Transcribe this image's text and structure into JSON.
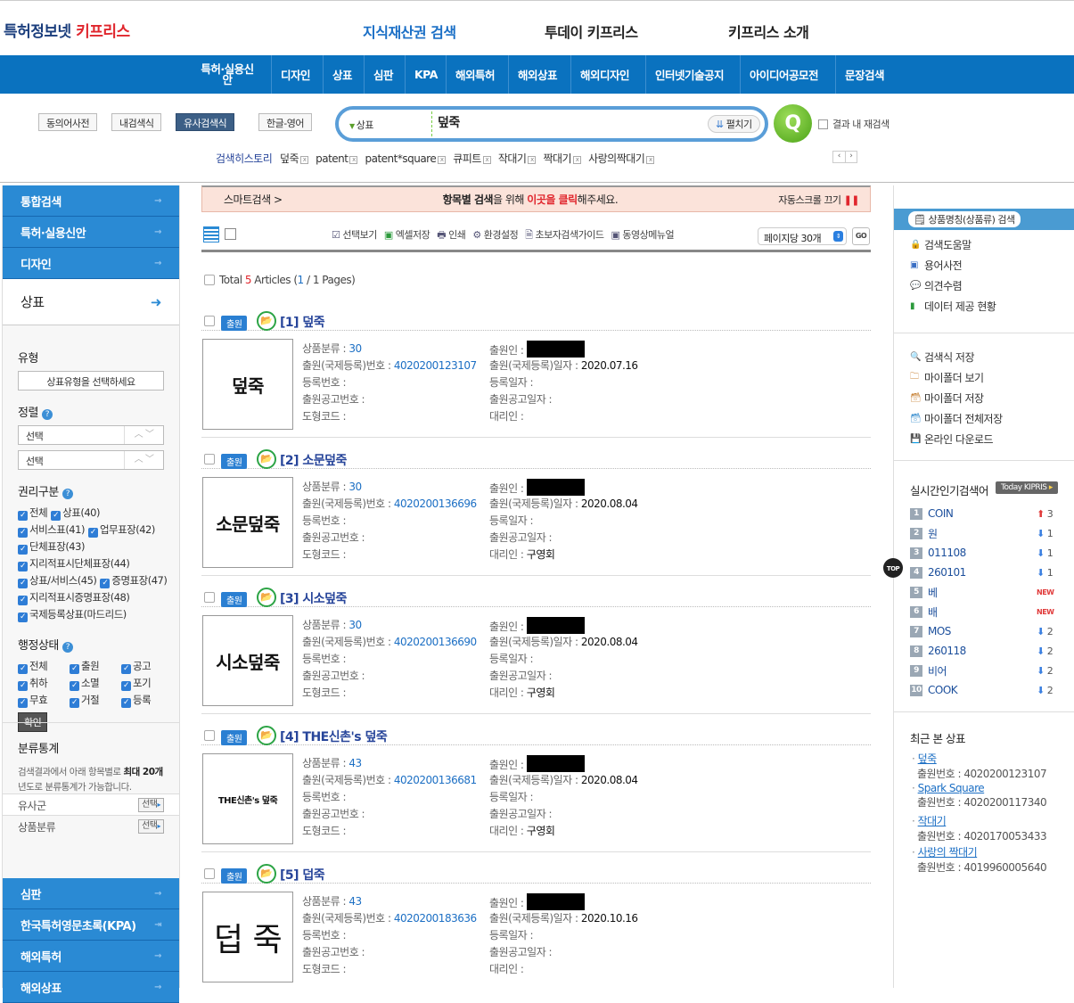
{
  "header": {
    "logo_main": "특허정보넷 ",
    "logo_accent": "키프리스",
    "tabs": [
      "지식재산권 검색",
      "투데이 키프리스",
      "키프리스 소개"
    ]
  },
  "nav": [
    "특허·실용신안",
    "디자인",
    "상표",
    "심판",
    "KPA",
    "해외특허",
    "해외상표",
    "해외디자인",
    "인터넷기술공지",
    "아이디어공모전",
    "문장검색"
  ],
  "search": {
    "tools": [
      "동의어사전",
      "내검색식",
      "유사검색식",
      "한글-영어"
    ],
    "category": "상표",
    "query": "덮죽",
    "expand": "펼치기",
    "within": "결과 내 재검색",
    "history_label": "검색히스토리",
    "history": [
      "덮죽",
      "patent",
      "patent*square",
      "큐피트",
      "작대기",
      "짝대기",
      "사랑의짝대기"
    ]
  },
  "left": {
    "top_items": [
      "통합검색",
      "특허·실용신안",
      "디자인"
    ],
    "selected": "상표",
    "type_label": "유형",
    "type_placeholder": "상표유형을 선택하세요",
    "sort_label": "정렬",
    "sort1": "선택",
    "sort2": "선택",
    "rights_label": "권리구분",
    "rights": [
      [
        "전체",
        "상표(40)"
      ],
      [
        "서비스표(41)",
        "업무표장(42)"
      ],
      [
        "단체표장(43)"
      ],
      [
        "지리적표시단체표장(44)"
      ],
      [
        "상표/서비스(45)",
        "증명표장(47)"
      ],
      [
        "지리적표시증명표장(48)"
      ],
      [
        "국제등록상표(마드리드)"
      ]
    ],
    "status_label": "행정상태",
    "status": [
      "전체",
      "출원",
      "공고",
      "취하",
      "소멸",
      "포기",
      "무효",
      "거절",
      "등록"
    ],
    "confirm": "확인",
    "stats_title": "분류통계",
    "stats_desc1": "검색결과에서 아래 항목별로 ",
    "stats_desc_bold": "최대 20개",
    "stats_desc2": "년도로 분류통계가 가능합니다.",
    "stats_rows": [
      "유사군",
      "상품분류"
    ],
    "select_btn": "선택",
    "bottom_items": [
      "심판",
      "한국특허영문초록(KPA)",
      "해외특허",
      "해외상표"
    ]
  },
  "main": {
    "smart_left": "스마트검색 >",
    "smart_mid1": "항목별 검색",
    "smart_mid2": "을 위해 ",
    "smart_mid_red": "이곳을 클릭",
    "smart_mid3": "해주세요.",
    "smart_right": "자동스크롤 끄기",
    "toolbar": [
      "선택보기",
      "엑셀저장",
      "인쇄",
      "환경설정",
      "초보자검색가이드",
      "동영상메뉴얼"
    ],
    "per_page": "페이지당 30개",
    "go": "GO",
    "total_prefix": "Total ",
    "total_count": "5",
    "total_mid": " Articles (",
    "page_cur": "1",
    "total_suffix": " / 1 Pages)",
    "labels": {
      "class": "상품분류 : ",
      "appno": "출원(국제등록)번호 : ",
      "regno": "등록번호 :",
      "pubno": "출원공고번호 :",
      "fig": "도형코드 :",
      "applicant": "출원인 : ",
      "appdate": "출원(국제등록)일자 : ",
      "regdate": "등록일자 :",
      "pubdate": "출원공고일자 :",
      "agent": "대리인 : "
    },
    "badge": "출원",
    "results": [
      {
        "title": "[1] 덮죽",
        "thumb": "덮죽",
        "class": "30",
        "appno": "4020200123107",
        "appdate": "2020.07.16",
        "agent": ""
      },
      {
        "title": "[2] 소문덮죽",
        "thumb": "소문덮죽",
        "class": "30",
        "appno": "4020200136696",
        "appdate": "2020.08.04",
        "agent": "구영회"
      },
      {
        "title": "[3] 시소덮죽",
        "thumb": "시소덮죽",
        "class": "30",
        "appno": "4020200136690",
        "appdate": "2020.08.04",
        "agent": "구영회"
      },
      {
        "title": "[4] THE신촌's 덮죽",
        "thumb": "THE신촌's 덮죽",
        "class": "43",
        "appno": "4020200136681",
        "appdate": "2020.08.04",
        "agent": "구영회"
      },
      {
        "title": "[5] 덥죽",
        "thumb": "덥 죽",
        "class": "43",
        "appno": "4020200183636",
        "appdate": "2020.10.16",
        "agent": ""
      }
    ]
  },
  "right": {
    "goods_search": "상품명칭(상품류) 검색",
    "links1": [
      "검색도움말",
      "용어사전",
      "의견수렴",
      "데이터 제공 현황"
    ],
    "links2": [
      "검색식 저장",
      "마이폴더 보기",
      "마이폴더 저장",
      "마이폴더 전체저장",
      "온라인 다운로드"
    ],
    "popular_title": "실시간인기검색어",
    "today": "Today KIPRIS",
    "popular": [
      {
        "t": "COIN",
        "d": "up",
        "c": "3"
      },
      {
        "t": "원",
        "d": "down",
        "c": "1"
      },
      {
        "t": "011108",
        "d": "down",
        "c": "1"
      },
      {
        "t": "260101",
        "d": "down",
        "c": "1"
      },
      {
        "t": "베",
        "d": "new",
        "c": "NEW"
      },
      {
        "t": "배",
        "d": "new",
        "c": "NEW"
      },
      {
        "t": "MOS",
        "d": "down",
        "c": "2"
      },
      {
        "t": "260118",
        "d": "down",
        "c": "2"
      },
      {
        "t": "비어",
        "d": "down",
        "c": "2"
      },
      {
        "t": "COOK",
        "d": "down",
        "c": "2"
      }
    ],
    "recent_title": "최근 본 상표",
    "recent_label": "출원번호 : ",
    "recent": [
      {
        "t": "덮죽",
        "n": "4020200123107"
      },
      {
        "t": "Spark Square",
        "n": "4020200117340"
      },
      {
        "t": "작대기",
        "n": "4020170053433"
      },
      {
        "t": "사랑의 짝대기",
        "n": "4019960005640"
      }
    ],
    "top_btn": "TOP"
  },
  "colors": {
    "nav": "#0a72bf",
    "accent_red": "#e0262d",
    "link": "#1c6fc4"
  }
}
